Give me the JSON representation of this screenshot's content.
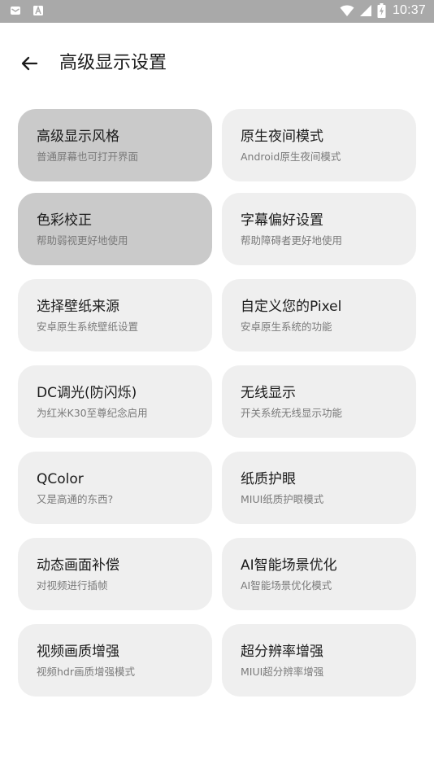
{
  "status_bar": {
    "time": "10:37",
    "left_icons": [
      "mail-notification-icon",
      "a-notification-icon"
    ],
    "right_icons": [
      "wifi-icon",
      "signal-icon",
      "battery-charging-icon"
    ]
  },
  "header": {
    "back_icon": "arrow-left-icon",
    "title": "高级显示设置"
  },
  "cards": [
    {
      "title": "高级显示风格",
      "subtitle": "普通屏幕也可打开界面",
      "selected": true
    },
    {
      "title": "原生夜间模式",
      "subtitle": "Android原生夜间模式",
      "selected": false
    },
    {
      "title": "色彩校正",
      "subtitle": "帮助弱视更好地使用",
      "selected": true
    },
    {
      "title": "字幕偏好设置",
      "subtitle": "帮助障碍者更好地使用",
      "selected": false
    },
    {
      "title": "选择壁纸来源",
      "subtitle": "安卓原生系统壁纸设置",
      "selected": false
    },
    {
      "title": "自定义您的Pixel",
      "subtitle": "安卓原生系统的功能",
      "selected": false
    },
    {
      "title": "DC调光(防闪烁)",
      "subtitle": "为红米K30至尊纪念启用",
      "selected": false
    },
    {
      "title": "无线显示",
      "subtitle": "开关系统无线显示功能",
      "selected": false
    },
    {
      "title": "QColor",
      "subtitle": "又是高通的东西?",
      "selected": false
    },
    {
      "title": "纸质护眼",
      "subtitle": "MIUI纸质护眼模式",
      "selected": false
    },
    {
      "title": "动态画面补偿",
      "subtitle": "对视频进行插帧",
      "selected": false
    },
    {
      "title": "AI智能场景优化",
      "subtitle": "AI智能场景优化模式",
      "selected": false
    },
    {
      "title": "视频画质增强",
      "subtitle": "视频hdr画质增强模式",
      "selected": false
    },
    {
      "title": "超分辨率增强",
      "subtitle": "MIUI超分辨率增强",
      "selected": false
    }
  ],
  "colors": {
    "status_bar_bg": "#a9a9a9",
    "card_bg": "#efefef",
    "card_selected_bg": "#cacaca",
    "title_text": "#1b1b1b",
    "subtitle_text": "#7a7a7a"
  }
}
